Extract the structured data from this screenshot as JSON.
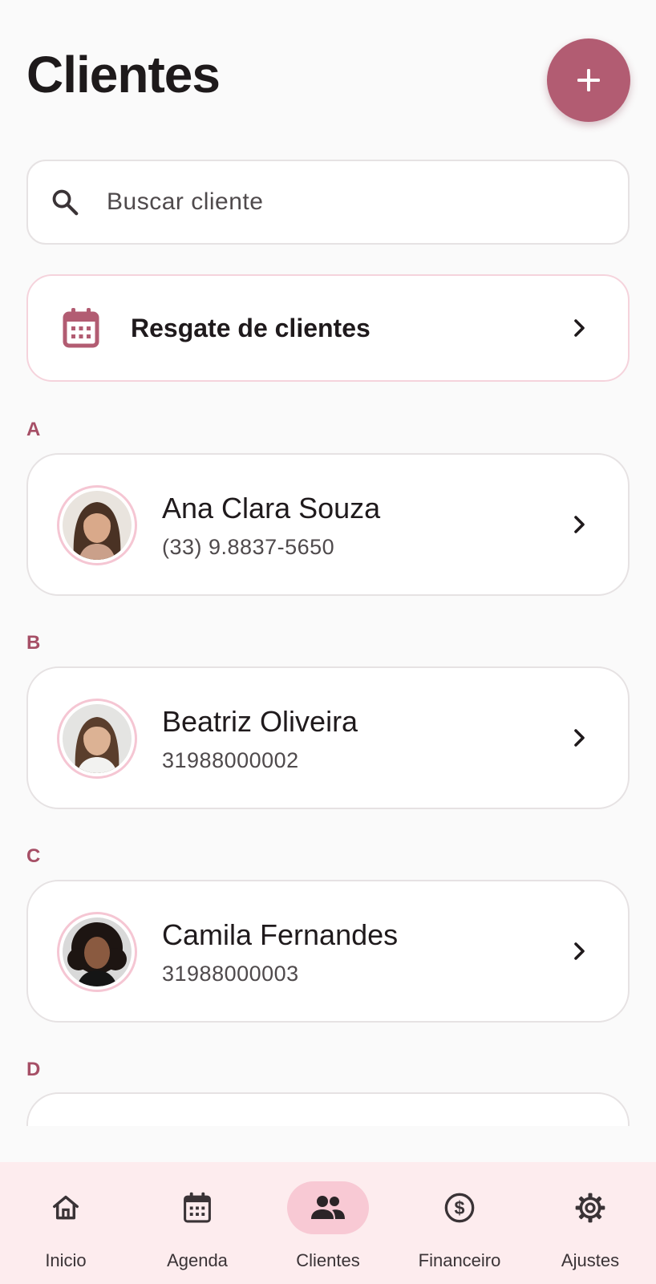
{
  "header": {
    "title": "Clientes",
    "add_button_icon": "plus-icon"
  },
  "search": {
    "placeholder": "Buscar cliente",
    "icon": "search-icon"
  },
  "rescue": {
    "label": "Resgate de clientes",
    "icon": "calendar-icon"
  },
  "sections": [
    {
      "letter": "A",
      "client": {
        "name": "Ana Clara Souza",
        "phone": "(33) 9.8837-5650"
      }
    },
    {
      "letter": "B",
      "client": {
        "name": "Beatriz Oliveira",
        "phone": "31988000002"
      }
    },
    {
      "letter": "C",
      "client": {
        "name": "Camila Fernandes",
        "phone": "31988000003"
      }
    },
    {
      "letter": "D"
    }
  ],
  "nav": [
    {
      "label": "Inicio",
      "icon": "home-icon",
      "active": false
    },
    {
      "label": "Agenda",
      "icon": "calendar-icon",
      "active": false
    },
    {
      "label": "Clientes",
      "icon": "people-icon",
      "active": true
    },
    {
      "label": "Financeiro",
      "icon": "dollar-icon",
      "active": false
    },
    {
      "label": "Ajustes",
      "icon": "gear-icon",
      "active": false
    }
  ],
  "colors": {
    "accent": "#b25c72",
    "section_letter": "#a64f66",
    "avatar_ring": "#f5c6d3",
    "nav_background": "#fdecee",
    "nav_active_pill": "#f8c9d4"
  }
}
